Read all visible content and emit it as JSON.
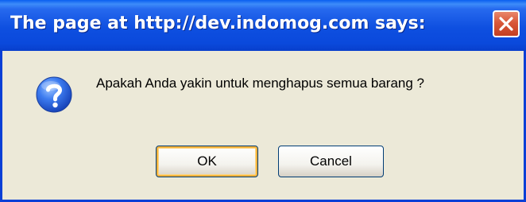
{
  "dialog": {
    "title": "The page at http://dev.indomog.com says:",
    "message": "Apakah Anda yakin untuk menghapus semua barang ?",
    "icon": "question-icon",
    "buttons": {
      "ok_label": "OK",
      "cancel_label": "Cancel"
    }
  },
  "colors": {
    "titlebar": "#0a49dc",
    "close_button": "#d9583a",
    "body": "#ece9d8",
    "border": "#0a3fd6",
    "icon": "#1f5fd6"
  }
}
